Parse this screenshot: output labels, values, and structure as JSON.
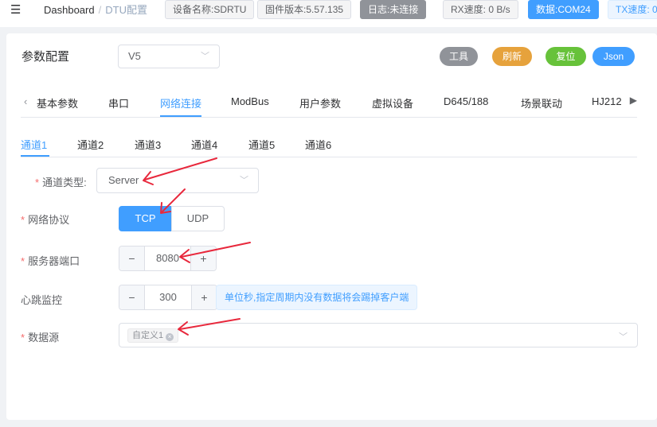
{
  "topbar": {
    "menu_icon": "indent-icon",
    "crumb_home": "Dashboard",
    "crumb_current": "DTU配置",
    "tags": [
      "设备名称:SDRTU",
      "固件版本:5.57.135",
      "日志:未连接",
      "RX速度: 0 B/s",
      "数据:COM24",
      "TX速度: 0"
    ]
  },
  "card": {
    "title": "参数配置",
    "version": "V5",
    "buttons": {
      "tools": "工具",
      "refresh": "刷新",
      "reset": "复位",
      "json": "Json"
    },
    "colors": {
      "tools": "#909399",
      "refresh": "#e6a23c",
      "reset": "#67c23a",
      "json": "#409eff"
    }
  },
  "tabs_main": [
    "基本参数",
    "串口",
    "网络连接",
    "ModBus",
    "用户参数",
    "虚拟设备",
    "D645/188",
    "场景联动",
    "HJ212"
  ],
  "tabs_main_active": "网络连接",
  "tabs_channel": [
    "通道1",
    "通道2",
    "通道3",
    "通道4",
    "通道5",
    "通道6"
  ],
  "tabs_channel_active": "通道1",
  "form": {
    "channel_type_label": "通道类型:",
    "channel_type_value": "Server",
    "protocol_label": "网络协议",
    "protocol_options": [
      "TCP",
      "UDP"
    ],
    "protocol_selected": "TCP",
    "port_label": "服务器端口",
    "port_value": "8080",
    "heartbeat_label": "心跳监控",
    "heartbeat_value": "300",
    "heartbeat_hint": "单位秒,指定周期内没有数据将会踢掉客户端",
    "datasource_label": "数据源",
    "datasource_chip": "自定义1"
  },
  "annotation_color": "#e8283c"
}
